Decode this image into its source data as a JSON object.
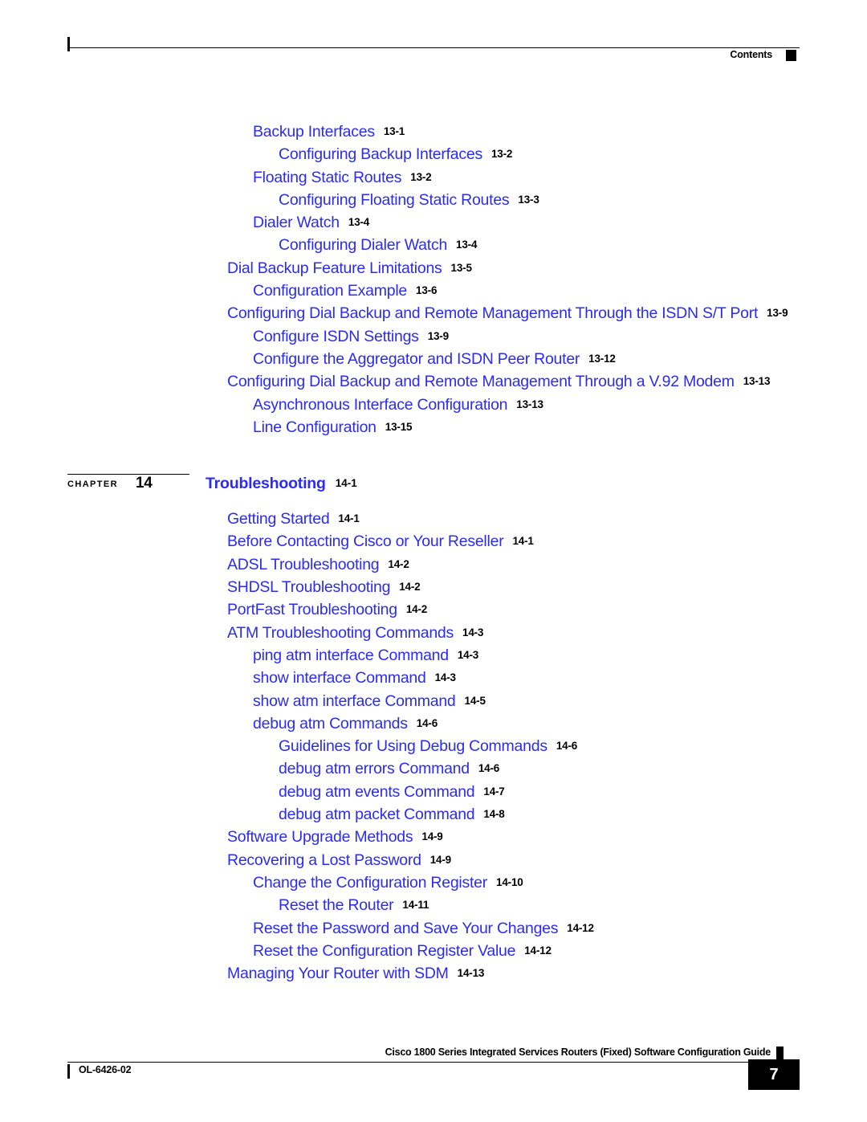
{
  "header": {
    "title": "Contents",
    "marker_icon": "black-square-icon"
  },
  "colors": {
    "link_blue": "#2b2bf2",
    "text_black": "#000000",
    "page_background": "#ffffff"
  },
  "toc": {
    "entries": [
      {
        "label": "Backup Interfaces",
        "page": "13-1",
        "level": 2
      },
      {
        "label": "Configuring Backup Interfaces",
        "page": "13-2",
        "level": 3
      },
      {
        "label": "Floating Static Routes",
        "page": "13-2",
        "level": 2
      },
      {
        "label": "Configuring Floating Static Routes",
        "page": "13-3",
        "level": 3
      },
      {
        "label": "Dialer Watch",
        "page": "13-4",
        "level": 2
      },
      {
        "label": "Configuring Dialer Watch",
        "page": "13-4",
        "level": 3
      },
      {
        "label": "Dial Backup Feature Limitations",
        "page": "13-5",
        "level": 1
      },
      {
        "label": "Configuration Example",
        "page": "13-6",
        "level": 2
      },
      {
        "label": "Configuring Dial Backup and Remote Management Through the ISDN S/T Port",
        "page": "13-9",
        "level": 1
      },
      {
        "label": "Configure ISDN Settings",
        "page": "13-9",
        "level": 2
      },
      {
        "label": "Configure the Aggregator and ISDN Peer Router",
        "page": "13-12",
        "level": 2
      },
      {
        "label": "Configuring Dial Backup and Remote Management Through a V.92 Modem",
        "page": "13-13",
        "level": 1
      },
      {
        "label": "Asynchronous Interface Configuration",
        "page": "13-13",
        "level": 2
      },
      {
        "label": "Line Configuration",
        "page": "13-15",
        "level": 2
      }
    ]
  },
  "chapter": {
    "chapter_word": "CHAPTER",
    "chapter_number": "14",
    "title": "Troubleshooting",
    "title_page": "14-1",
    "entries": [
      {
        "label": "Getting Started",
        "page": "14-1",
        "level": 1
      },
      {
        "label": "Before Contacting Cisco or Your Reseller",
        "page": "14-1",
        "level": 1
      },
      {
        "label": "ADSL Troubleshooting",
        "page": "14-2",
        "level": 1
      },
      {
        "label": "SHDSL Troubleshooting",
        "page": "14-2",
        "level": 1
      },
      {
        "label": "PortFast Troubleshooting",
        "page": "14-2",
        "level": 1
      },
      {
        "label": "ATM Troubleshooting Commands",
        "page": "14-3",
        "level": 1
      },
      {
        "label": "ping atm interface Command",
        "page": "14-3",
        "level": 2
      },
      {
        "label": "show interface Command",
        "page": "14-3",
        "level": 2
      },
      {
        "label": "show atm interface Command",
        "page": "14-5",
        "level": 2
      },
      {
        "label": "debug atm Commands",
        "page": "14-6",
        "level": 2
      },
      {
        "label": "Guidelines for Using Debug Commands",
        "page": "14-6",
        "level": 3
      },
      {
        "label": "debug atm errors Command",
        "page": "14-6",
        "level": 3
      },
      {
        "label": "debug atm events Command",
        "page": "14-7",
        "level": 3
      },
      {
        "label": "debug atm packet Command",
        "page": "14-8",
        "level": 3
      },
      {
        "label": "Software Upgrade Methods",
        "page": "14-9",
        "level": 1
      },
      {
        "label": "Recovering a Lost Password",
        "page": "14-9",
        "level": 1
      },
      {
        "label": "Change the Configuration Register",
        "page": "14-10",
        "level": 2
      },
      {
        "label": "Reset the Router",
        "page": "14-11",
        "level": 3
      },
      {
        "label": "Reset the Password and Save Your Changes",
        "page": "14-12",
        "level": 2
      },
      {
        "label": "Reset the Configuration Register Value",
        "page": "14-12",
        "level": 2
      },
      {
        "label": "Managing Your Router with SDM",
        "page": "14-13",
        "level": 1
      }
    ]
  },
  "footer": {
    "guide_title": "Cisco 1800 Series Integrated Services Routers (Fixed) Software Configuration Guide",
    "doc_id": "OL-6426-02",
    "page_number": "7",
    "marker_icon": "black-square-icon"
  }
}
